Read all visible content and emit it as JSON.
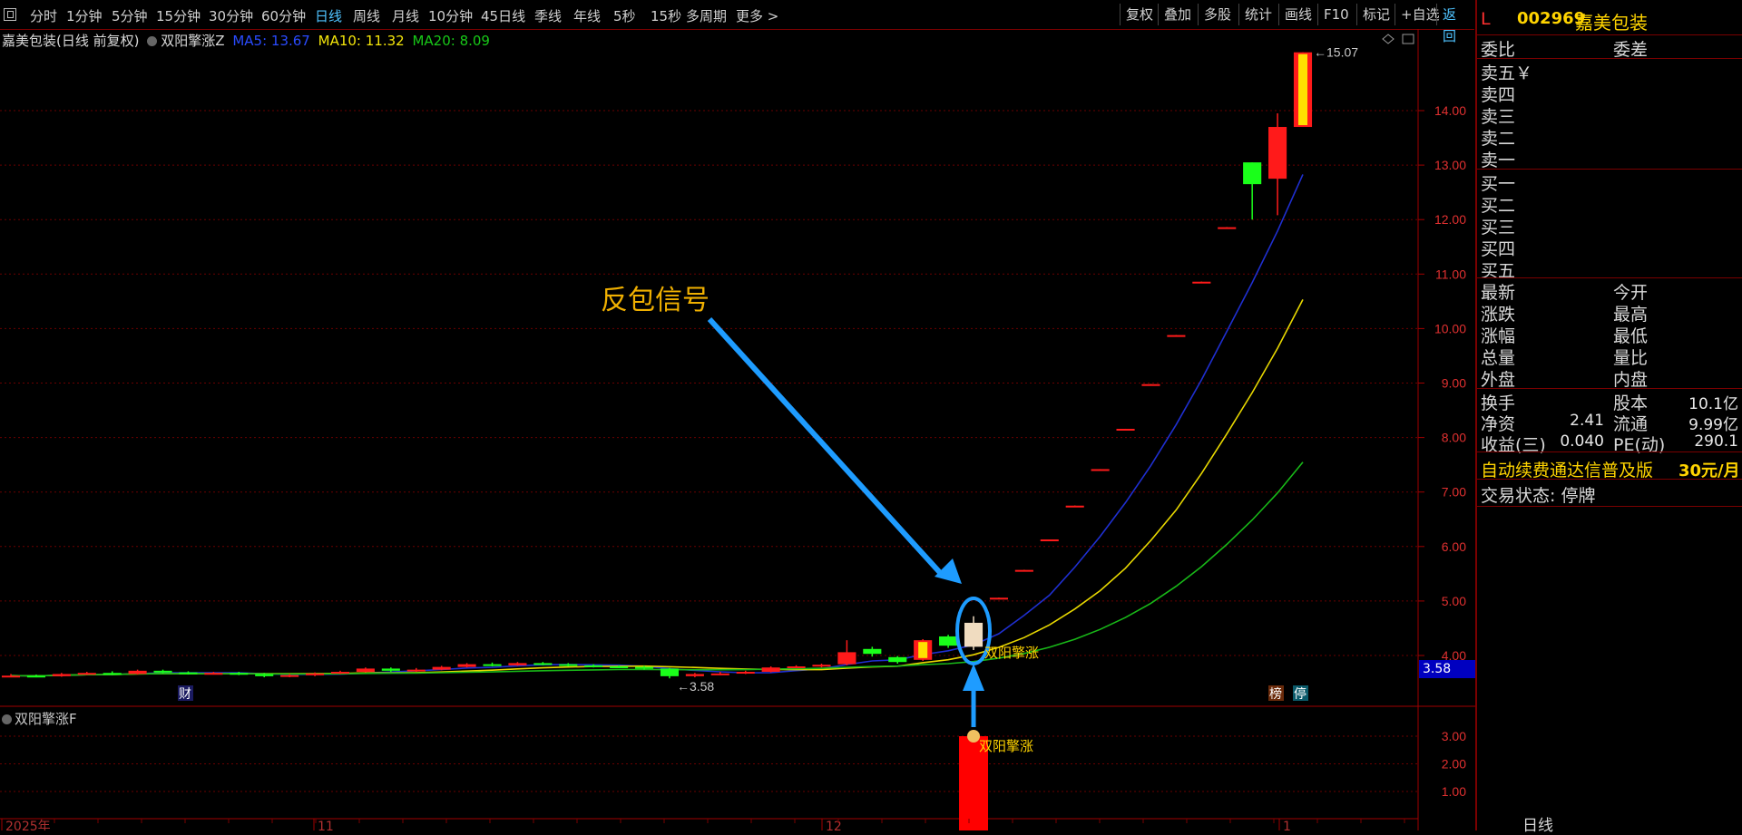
{
  "toolbar": {
    "periods": [
      {
        "label": "分时",
        "active": false
      },
      {
        "label": "1分钟",
        "active": false
      },
      {
        "label": "5分钟",
        "active": false
      },
      {
        "label": "15分钟",
        "active": false
      },
      {
        "label": "30分钟",
        "active": false
      },
      {
        "label": "60分钟",
        "active": false
      },
      {
        "label": "日线",
        "active": true
      },
      {
        "label": "周线",
        "active": false
      },
      {
        "label": "月线",
        "active": false
      },
      {
        "label": "10分钟",
        "active": false
      },
      {
        "label": "45日线",
        "active": false
      },
      {
        "label": "季线",
        "active": false
      },
      {
        "label": "年线",
        "active": false
      },
      {
        "label": "5秒",
        "active": false
      },
      {
        "label": "15秒",
        "active": false
      },
      {
        "label": "多周期",
        "active": false
      },
      {
        "label": "更多 >",
        "active": false
      }
    ],
    "tools": [
      "复权",
      "叠加",
      "多股",
      "统计",
      "画线",
      "F10",
      "标记",
      "+自选",
      "返回"
    ]
  },
  "legend": {
    "stock": "嘉美包装(日线 前复权)",
    "indicator": "双阳擎涨Z",
    "ma5": "MA5: 13.67",
    "ma10": "MA10: 11.32",
    "ma20": "MA20: 8.09",
    "colors": {
      "ma5": "#1f3fff",
      "ma10": "#f5e60a",
      "ma20": "#18c818"
    }
  },
  "sub_indicator": {
    "title": "双阳擎涨F",
    "label": "双阳擎涨"
  },
  "annotation": {
    "text": "反包信号",
    "signal_label": "双阳擎涨"
  },
  "price_tag": "3.58",
  "markers": {
    "cai": "财",
    "bang": "榜",
    "ting": "停",
    "high_label": "15.07",
    "low_label": "3.58"
  },
  "x_labels": [
    "2025年",
    "11",
    "12",
    "1"
  ],
  "right_panel": {
    "letter": "L",
    "code": "002969",
    "name": "嘉美包装",
    "weibi": "委比",
    "weicha": "委差",
    "sell": [
      "卖五",
      "卖四",
      "卖三",
      "卖二",
      "卖一"
    ],
    "sell5_suffix": "￥",
    "buy": [
      "买一",
      "买二",
      "买三",
      "买四",
      "买五"
    ],
    "quote_left": [
      "最新",
      "涨跌",
      "涨幅",
      "总量",
      "外盘"
    ],
    "quote_right": [
      "今开",
      "最高",
      "最低",
      "量比",
      "内盘"
    ],
    "stats": [
      {
        "l": "换手",
        "lv": "",
        "r": "股本",
        "rv": "10.1亿"
      },
      {
        "l": "净资",
        "lv": "2.41",
        "r": "流通",
        "rv": "9.99亿"
      },
      {
        "l": "收益(三)",
        "lv": "0.040",
        "r": "PE(动)",
        "rv": "290.1"
      }
    ],
    "promo": "自动续费通达信普及版",
    "promo_price": "30元/月",
    "status": "交易状态: 停牌",
    "bottom_tab": "日线"
  },
  "chart_data": {
    "type": "candlestick",
    "y_ticks": [
      4.0,
      5.0,
      6.0,
      7.0,
      8.0,
      9.0,
      10.0,
      11.0,
      12.0,
      13.0,
      14.0
    ],
    "sub_y_ticks": [
      1.0,
      2.0,
      3.0
    ],
    "ylim": [
      3.2,
      15.3
    ],
    "series": [
      {
        "name": "MA5",
        "values": []
      },
      {
        "name": "MA10",
        "values": []
      },
      {
        "name": "MA20",
        "values": []
      }
    ],
    "candles": [
      {
        "o": 3.62,
        "c": 3.63,
        "h": 3.66,
        "l": 3.6
      },
      {
        "o": 3.63,
        "c": 3.62,
        "h": 3.65,
        "l": 3.6
      },
      {
        "o": 3.62,
        "c": 3.66,
        "h": 3.68,
        "l": 3.61
      },
      {
        "o": 3.65,
        "c": 3.68,
        "h": 3.7,
        "l": 3.64
      },
      {
        "o": 3.68,
        "c": 3.66,
        "h": 3.71,
        "l": 3.64
      },
      {
        "o": 3.66,
        "c": 3.72,
        "h": 3.74,
        "l": 3.65
      },
      {
        "o": 3.72,
        "c": 3.69,
        "h": 3.74,
        "l": 3.67
      },
      {
        "o": 3.69,
        "c": 3.67,
        "h": 3.71,
        "l": 3.65
      },
      {
        "o": 3.67,
        "c": 3.68,
        "h": 3.7,
        "l": 3.65
      },
      {
        "o": 3.68,
        "c": 3.66,
        "h": 3.7,
        "l": 3.64
      },
      {
        "o": 3.66,
        "c": 3.62,
        "h": 3.68,
        "l": 3.6
      },
      {
        "o": 3.62,
        "c": 3.64,
        "h": 3.66,
        "l": 3.6
      },
      {
        "o": 3.64,
        "c": 3.67,
        "h": 3.69,
        "l": 3.62
      },
      {
        "o": 3.67,
        "c": 3.7,
        "h": 3.72,
        "l": 3.66
      },
      {
        "o": 3.7,
        "c": 3.76,
        "h": 3.78,
        "l": 3.69
      },
      {
        "o": 3.76,
        "c": 3.72,
        "h": 3.78,
        "l": 3.7
      },
      {
        "o": 3.72,
        "c": 3.74,
        "h": 3.77,
        "l": 3.7
      },
      {
        "o": 3.74,
        "c": 3.79,
        "h": 3.81,
        "l": 3.73
      },
      {
        "o": 3.79,
        "c": 3.84,
        "h": 3.86,
        "l": 3.78
      },
      {
        "o": 3.84,
        "c": 3.82,
        "h": 3.87,
        "l": 3.8
      },
      {
        "o": 3.82,
        "c": 3.86,
        "h": 3.88,
        "l": 3.81
      },
      {
        "o": 3.86,
        "c": 3.84,
        "h": 3.88,
        "l": 3.82
      },
      {
        "o": 3.84,
        "c": 3.82,
        "h": 3.86,
        "l": 3.8
      },
      {
        "o": 3.82,
        "c": 3.8,
        "h": 3.84,
        "l": 3.78
      },
      {
        "o": 3.8,
        "c": 3.79,
        "h": 3.82,
        "l": 3.77
      },
      {
        "o": 3.79,
        "c": 3.76,
        "h": 3.81,
        "l": 3.74
      },
      {
        "o": 3.76,
        "c": 3.62,
        "h": 3.77,
        "l": 3.58
      },
      {
        "o": 3.62,
        "c": 3.66,
        "h": 3.68,
        "l": 3.6
      },
      {
        "o": 3.66,
        "c": 3.67,
        "h": 3.7,
        "l": 3.64
      },
      {
        "o": 3.67,
        "c": 3.7,
        "h": 3.72,
        "l": 3.66
      },
      {
        "o": 3.7,
        "c": 3.78,
        "h": 3.8,
        "l": 3.69
      },
      {
        "o": 3.78,
        "c": 3.8,
        "h": 3.82,
        "l": 3.77
      },
      {
        "o": 3.8,
        "c": 3.83,
        "h": 3.85,
        "l": 3.78
      },
      {
        "o": 3.84,
        "c": 4.06,
        "h": 4.28,
        "l": 3.82
      },
      {
        "o": 4.12,
        "c": 4.03,
        "h": 4.16,
        "l": 3.98
      },
      {
        "o": 3.97,
        "c": 3.88,
        "h": 3.99,
        "l": 3.85
      },
      {
        "o": 3.92,
        "c": 4.28,
        "h": 4.3,
        "l": 3.9,
        "cls": "limit"
      },
      {
        "o": 4.35,
        "c": 4.18,
        "h": 4.38,
        "l": 4.14
      },
      {
        "o": 4.16,
        "c": 4.6,
        "h": 4.72,
        "l": 4.1,
        "cls": "signal"
      },
      {
        "o": 5.05,
        "c": 5.06,
        "h": 5.06,
        "l": 5.05,
        "cls": "dash"
      },
      {
        "o": 5.56,
        "c": 5.57,
        "h": 5.57,
        "l": 5.56,
        "cls": "dash"
      },
      {
        "o": 6.12,
        "c": 6.13,
        "h": 6.13,
        "l": 6.12,
        "cls": "dash"
      },
      {
        "o": 6.74,
        "c": 6.75,
        "h": 6.75,
        "l": 6.74,
        "cls": "dash"
      },
      {
        "o": 7.41,
        "c": 7.42,
        "h": 7.42,
        "l": 7.41,
        "cls": "dash"
      },
      {
        "o": 8.15,
        "c": 8.16,
        "h": 8.16,
        "l": 8.15,
        "cls": "dash"
      },
      {
        "o": 8.97,
        "c": 8.98,
        "h": 8.98,
        "l": 8.97,
        "cls": "dash"
      },
      {
        "o": 9.87,
        "c": 9.88,
        "h": 9.88,
        "l": 9.87,
        "cls": "dash"
      },
      {
        "o": 10.85,
        "c": 10.86,
        "h": 10.86,
        "l": 10.85,
        "cls": "dash"
      },
      {
        "o": 11.85,
        "c": 11.86,
        "h": 11.86,
        "l": 11.85,
        "cls": "dash"
      },
      {
        "o": 13.05,
        "c": 12.65,
        "h": 13.05,
        "l": 12.0
      },
      {
        "o": 12.75,
        "c": 13.7,
        "h": 13.95,
        "l": 12.08
      },
      {
        "o": 13.7,
        "c": 15.07,
        "h": 15.07,
        "l": 13.7,
        "cls": "limit"
      }
    ]
  }
}
